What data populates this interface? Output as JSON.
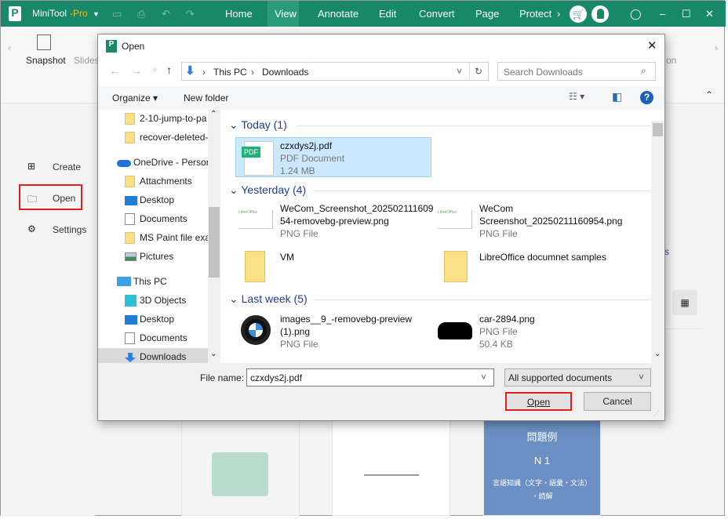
{
  "app": {
    "title": "MiniTool",
    "title_suffix": "-Pro",
    "menu": [
      "Home",
      "View",
      "Annotate",
      "Edit",
      "Convert",
      "Page",
      "Protect"
    ],
    "active_menu": "View",
    "accent": "#17886a"
  },
  "ribbon": {
    "items": [
      "Snapshot",
      "Slides"
    ],
    "right_fragment": "on"
  },
  "leftnav": {
    "items": [
      "Create",
      "Open",
      "Settings"
    ],
    "highlight": "Open"
  },
  "background": {
    "thumb_text": {
      "title": "問題例",
      "level": "N 1",
      "line1": "言語知識（文字・語彙・文法）",
      "line2": "・読解"
    },
    "fragment": "s"
  },
  "dialog": {
    "title": "Open",
    "path": [
      "This PC",
      "Downloads"
    ],
    "search_placeholder": "Search Downloads",
    "organize": "Organize",
    "new_folder": "New folder",
    "nav": [
      {
        "label": "2-10-jump-to-pa",
        "icon": "folder-icon"
      },
      {
        "label": "recover-deleted-",
        "icon": "folder-icon"
      },
      {
        "label": "OneDrive - Persor",
        "icon": "onedrive-icon"
      },
      {
        "label": "Attachments",
        "icon": "folder-icon"
      },
      {
        "label": "Desktop",
        "icon": "desktop-icon"
      },
      {
        "label": "Documents",
        "icon": "documents-icon"
      },
      {
        "label": "MS Paint file exa",
        "icon": "folder-icon"
      },
      {
        "label": "Pictures",
        "icon": "pictures-icon"
      },
      {
        "label": "This PC",
        "icon": "pc-icon"
      },
      {
        "label": "3D Objects",
        "icon": "3d-objects-icon"
      },
      {
        "label": "Desktop",
        "icon": "desktop-icon"
      },
      {
        "label": "Documents",
        "icon": "documents-icon"
      },
      {
        "label": "Downloads",
        "icon": "downloads-icon"
      }
    ],
    "groups": [
      {
        "label": "Today (1)",
        "files": [
          {
            "name": "czxdys2j.pdf",
            "type": "PDF Document",
            "size": "1.24 MB",
            "selected": true
          }
        ]
      },
      {
        "label": "Yesterday (4)",
        "files": [
          {
            "name": "WeCom_Screenshot_20250211160954-removebg-preview.png",
            "line1": "WeCom_Screenshot_202502111609",
            "line2": "54-removebg-preview.png",
            "type": "PNG File"
          },
          {
            "name": "WeCom Screenshot_20250211160954.png",
            "line1": "WeCom",
            "line2": "Screenshot_20250211160954.png",
            "type": "PNG File"
          },
          {
            "name": "VM"
          },
          {
            "name": "LibreOffice documnet samples"
          }
        ]
      },
      {
        "label": "Last week (5)",
        "files": [
          {
            "name": "images__9_-removebg-preview (1).png",
            "line1": "images__9_-removebg-preview",
            "line2": "(1).png",
            "type": "PNG File"
          },
          {
            "name": "car-2894.png",
            "type": "PNG File",
            "size": "50.4 KB"
          }
        ]
      }
    ],
    "file_name_label": "File name:",
    "file_name": "czxdys2j.pdf",
    "filter": "All supported documents",
    "open": "Open",
    "cancel": "Cancel"
  }
}
